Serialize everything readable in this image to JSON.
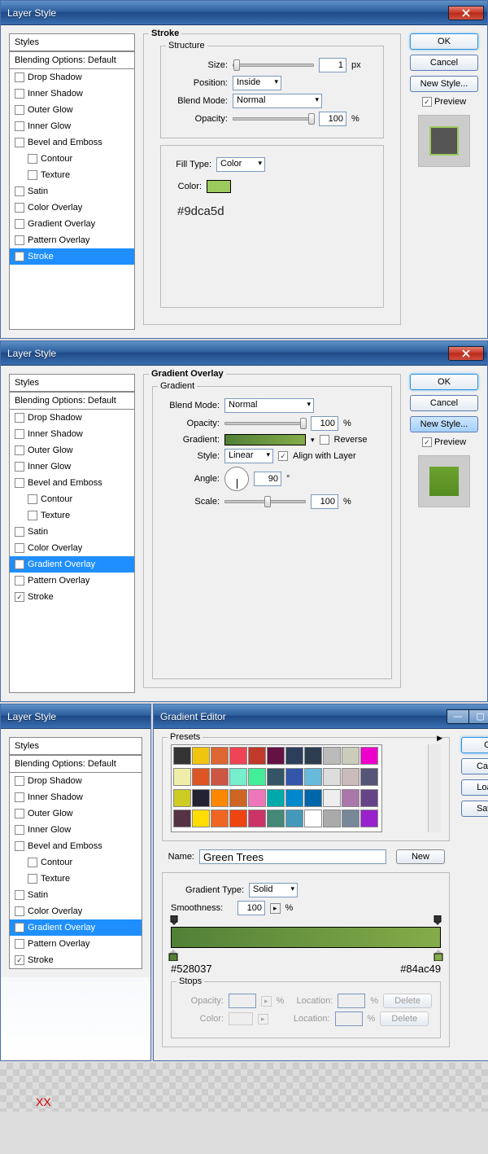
{
  "dialog1": {
    "title": "Layer Style",
    "styles_header": "Styles",
    "blending_options": "Blending Options: Default",
    "items": [
      "Drop Shadow",
      "Inner Shadow",
      "Outer Glow",
      "Inner Glow",
      "Bevel and Emboss",
      "Contour",
      "Texture",
      "Satin",
      "Color Overlay",
      "Gradient Overlay",
      "Pattern Overlay",
      "Stroke"
    ],
    "stroke_title": "Stroke",
    "structure_title": "Structure",
    "size_label": "Size:",
    "size_value": "1",
    "px": "px",
    "position_label": "Position:",
    "position_value": "Inside",
    "blend_mode_label": "Blend Mode:",
    "blend_mode_value": "Normal",
    "opacity_label": "Opacity:",
    "opacity_value": "100",
    "percent": "%",
    "fill_type_label": "Fill Type:",
    "fill_type_value": "Color",
    "color_label": "Color:",
    "color_swatch": "#9dca5d",
    "color_text": "#9dca5d",
    "ok": "OK",
    "cancel": "Cancel",
    "new_style": "New Style...",
    "preview": "Preview"
  },
  "dialog2": {
    "title": "Layer Style",
    "grad_overlay_title": "Gradient Overlay",
    "gradient_title": "Gradient",
    "blend_mode_label": "Blend Mode:",
    "blend_mode_value": "Normal",
    "opacity_label": "Opacity:",
    "opacity_value": "100",
    "percent": "%",
    "gradient_label": "Gradient:",
    "reverse_label": "Reverse",
    "style_label": "Style:",
    "style_value": "Linear",
    "align_label": "Align with Layer",
    "angle_label": "Angle:",
    "angle_value": "90",
    "degree": "°",
    "scale_label": "Scale:",
    "scale_value": "100",
    "ok": "OK",
    "cancel": "Cancel",
    "new_style": "New Style...",
    "preview": "Preview",
    "preview_color": "#6da32f"
  },
  "dialog3": {
    "title": "Layer Style"
  },
  "gradient_editor": {
    "title": "Gradient Editor",
    "presets_label": "Presets",
    "ok": "OK",
    "cancel": "Cancel",
    "load": "Load...",
    "save": "Save...",
    "name_label": "Name:",
    "name_value": "Green Trees",
    "new": "New",
    "grad_type_label": "Gradient Type:",
    "grad_type_value": "Solid",
    "smoothness_label": "Smoothness:",
    "smoothness_value": "100",
    "percent": "%",
    "stop_left": "#528037",
    "stop_right": "#84ac49",
    "stops_label": "Stops",
    "opacity_l": "Opacity:",
    "location_l": "Location:",
    "color_l": "Color:",
    "delete": "Delete",
    "preset_colors": [
      "#333",
      "#f1c40f",
      "#d63",
      "#e45",
      "#c0392b",
      "#614",
      "#2c3e5a",
      "#2c3e50",
      "#bbb",
      "#ccb",
      "#e0c",
      "#eea",
      "#d52",
      "#c54",
      "#7ec",
      "#4e9",
      "#356",
      "#35a",
      "#6bd",
      "#ddd",
      "#cbb",
      "#557",
      "#cc2",
      "#223",
      "#f80",
      "#c62",
      "#e7b",
      "#0aa",
      "#08c",
      "#06a",
      "#eee",
      "#a7a",
      "#648",
      "#534",
      "#fd0",
      "#e62",
      "#e41",
      "#c36",
      "#487",
      "#49b",
      "#fff",
      "#aaa",
      "#789",
      "#92c"
    ]
  },
  "footer_text": "XX"
}
